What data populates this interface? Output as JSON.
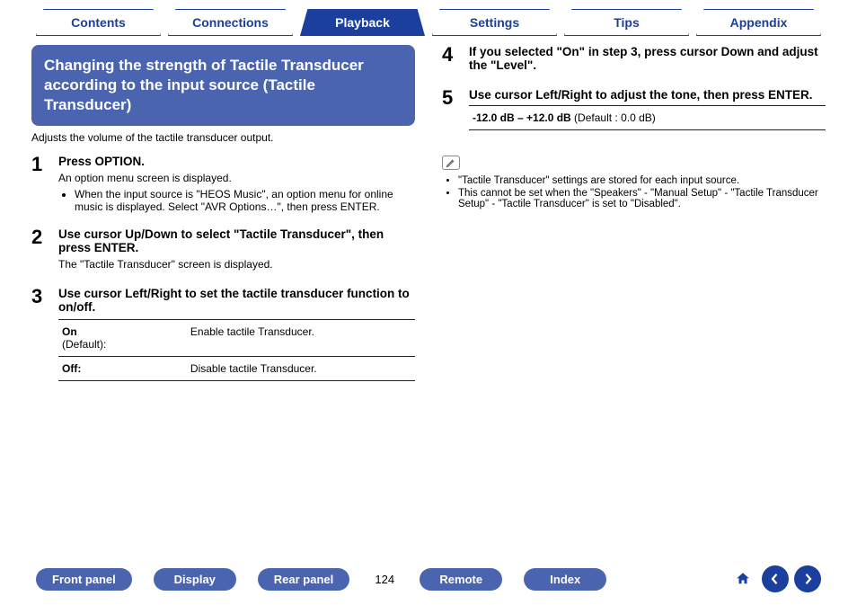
{
  "tabs": {
    "contents": "Contents",
    "connections": "Connections",
    "playback": "Playback",
    "settings": "Settings",
    "tips": "Tips",
    "appendix": "Appendix"
  },
  "section": {
    "title": "Changing the strength of Tactile Transducer according to the input source (Tactile Transducer)",
    "subtitle": "Adjusts the volume of the tactile transducer output."
  },
  "step1": {
    "num": "1",
    "title": "Press OPTION.",
    "sub": "An option menu screen is displayed.",
    "bullet": "When the input source is \"HEOS Music\", an option menu for online music is displayed. Select \"AVR Options…\", then press ENTER."
  },
  "step2": {
    "num": "2",
    "title": "Use cursor Up/Down to select \"Tactile Transducer\", then press ENTER.",
    "sub": "The \"Tactile Transducer\" screen is displayed."
  },
  "step3": {
    "num": "3",
    "title": "Use cursor Left/Right to set the tactile transducer function to on/off.",
    "on_label": "On",
    "on_default": "(Default):",
    "on_desc": "Enable tactile Transducer.",
    "off_label": "Off:",
    "off_desc": "Disable tactile Transducer."
  },
  "step4": {
    "num": "4",
    "title": "If you selected \"On\" in step 3, press cursor Down and adjust the \"Level\"."
  },
  "step5": {
    "num": "5",
    "title": "Use cursor Left/Right to adjust the tone, then press ENTER.",
    "range_bold": "-12.0 dB – +12.0 dB",
    "range_rest": " (Default : 0.0 dB)"
  },
  "notes": {
    "n1": "\"Tactile Transducer\" settings are stored for each input source.",
    "n2": "This cannot be set when the \"Speakers\" - \"Manual Setup\" - \"Tactile Transducer Setup\" - \"Tactile Transducer\" is set to \"Disabled\"."
  },
  "footer": {
    "front_panel": "Front panel",
    "display": "Display",
    "rear_panel": "Rear panel",
    "page": "124",
    "remote": "Remote",
    "index": "Index"
  }
}
